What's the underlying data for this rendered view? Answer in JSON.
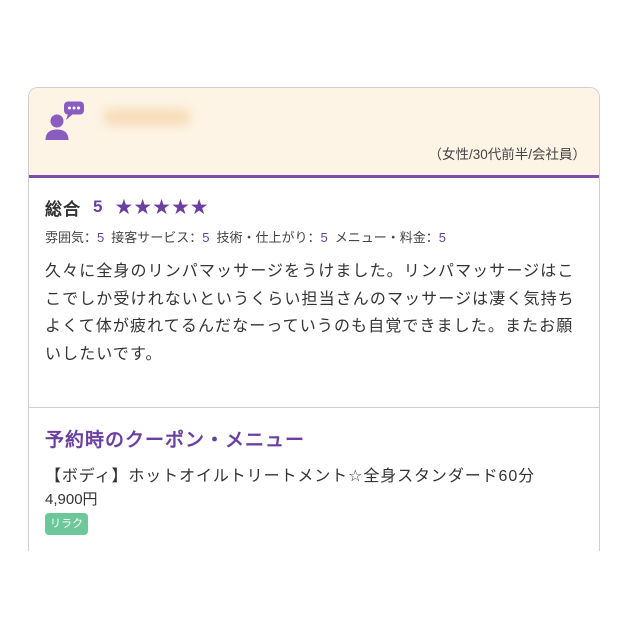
{
  "review": {
    "demographics": "（女性/30代前半/会社員）",
    "overall_label": "総合",
    "overall_score": "5",
    "stars": "★★★★★",
    "star_rating": 5,
    "sub_ratings": [
      {
        "label": "雰囲気：",
        "score": "5"
      },
      {
        "label": "接客サービス：",
        "score": "5"
      },
      {
        "label": "技術・仕上がり：",
        "score": "5"
      },
      {
        "label": "メニュー・料金：",
        "score": "5"
      }
    ],
    "body": "久々に全身のリンパマッサージをうけました。リンパマッサージはここでしか受けれないというくらい担当さんのマッサージは凄く気持ちよくて体が疲れてるんだなーっていうのも自覚できました。またお願いしたいです。"
  },
  "coupon": {
    "heading": "予約時のクーポン・メニュー",
    "name": "【ボディ】ホットオイルトリートメント☆全身スタンダード60分",
    "price": "4,900円",
    "badge": "リラク"
  },
  "icons": {
    "avatar": "reviewer-avatar-icon",
    "bubble": "speech-bubble-icon"
  },
  "colors": {
    "accent": "#6b3fa0",
    "header_bg": "#fdf4e6",
    "header_border": "#7b4fa8",
    "badge_bg": "#6cc89a"
  }
}
